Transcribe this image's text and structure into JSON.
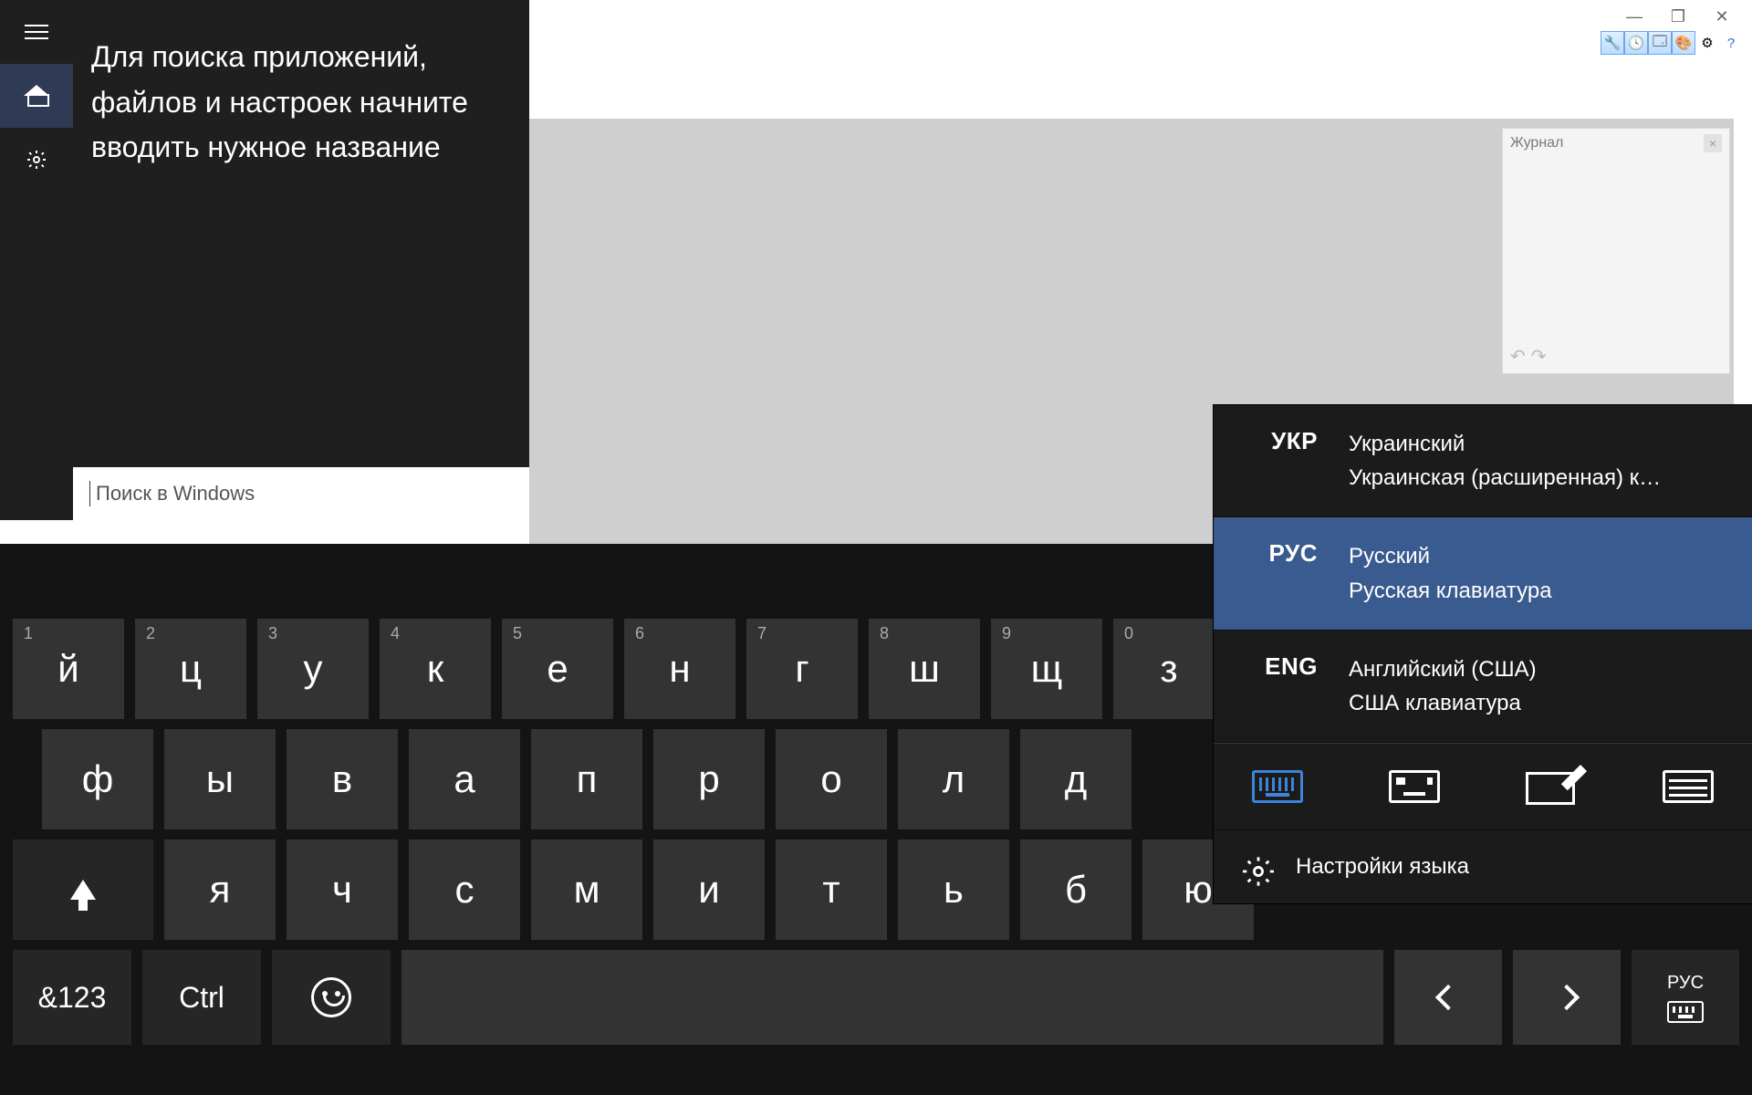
{
  "window_controls": {
    "min": "—",
    "max": "❐",
    "close": "✕"
  },
  "toolbar_icons": [
    "🔧",
    "🕓",
    "🗔",
    "🎨",
    "⚙",
    "?"
  ],
  "history": {
    "title": "Журнал",
    "undo": "↶",
    "redo": "↷"
  },
  "search": {
    "hint": "Для поиска приложений, файлов и настроек начните вводить нужное название",
    "placeholder": "Поиск в Windows"
  },
  "keyboard": {
    "row1": [
      {
        "k": "й",
        "s": "1"
      },
      {
        "k": "ц",
        "s": "2"
      },
      {
        "k": "у",
        "s": "3"
      },
      {
        "k": "к",
        "s": "4"
      },
      {
        "k": "е",
        "s": "5"
      },
      {
        "k": "н",
        "s": "6"
      },
      {
        "k": "г",
        "s": "7"
      },
      {
        "k": "ш",
        "s": "8"
      },
      {
        "k": "щ",
        "s": "9"
      },
      {
        "k": "з",
        "s": "0"
      }
    ],
    "row2": [
      "ф",
      "ы",
      "в",
      "а",
      "п",
      "р",
      "о",
      "л",
      "д"
    ],
    "row3": [
      "я",
      "ч",
      "с",
      "м",
      "и",
      "т",
      "ь",
      "б",
      "ю"
    ],
    "symnum": "&123",
    "ctrl": "Ctrl",
    "cur_lang": "РУС"
  },
  "languages": {
    "items": [
      {
        "code": "УКР",
        "name": "Украинский",
        "layout": "Украинская (расширенная) к…",
        "selected": false
      },
      {
        "code": "РУС",
        "name": "Русский",
        "layout": "Русская клавиатура",
        "selected": true
      },
      {
        "code": "ENG",
        "name": "Английский (США)",
        "layout": "США клавиатура",
        "selected": false
      }
    ],
    "settings": "Настройки языка"
  }
}
